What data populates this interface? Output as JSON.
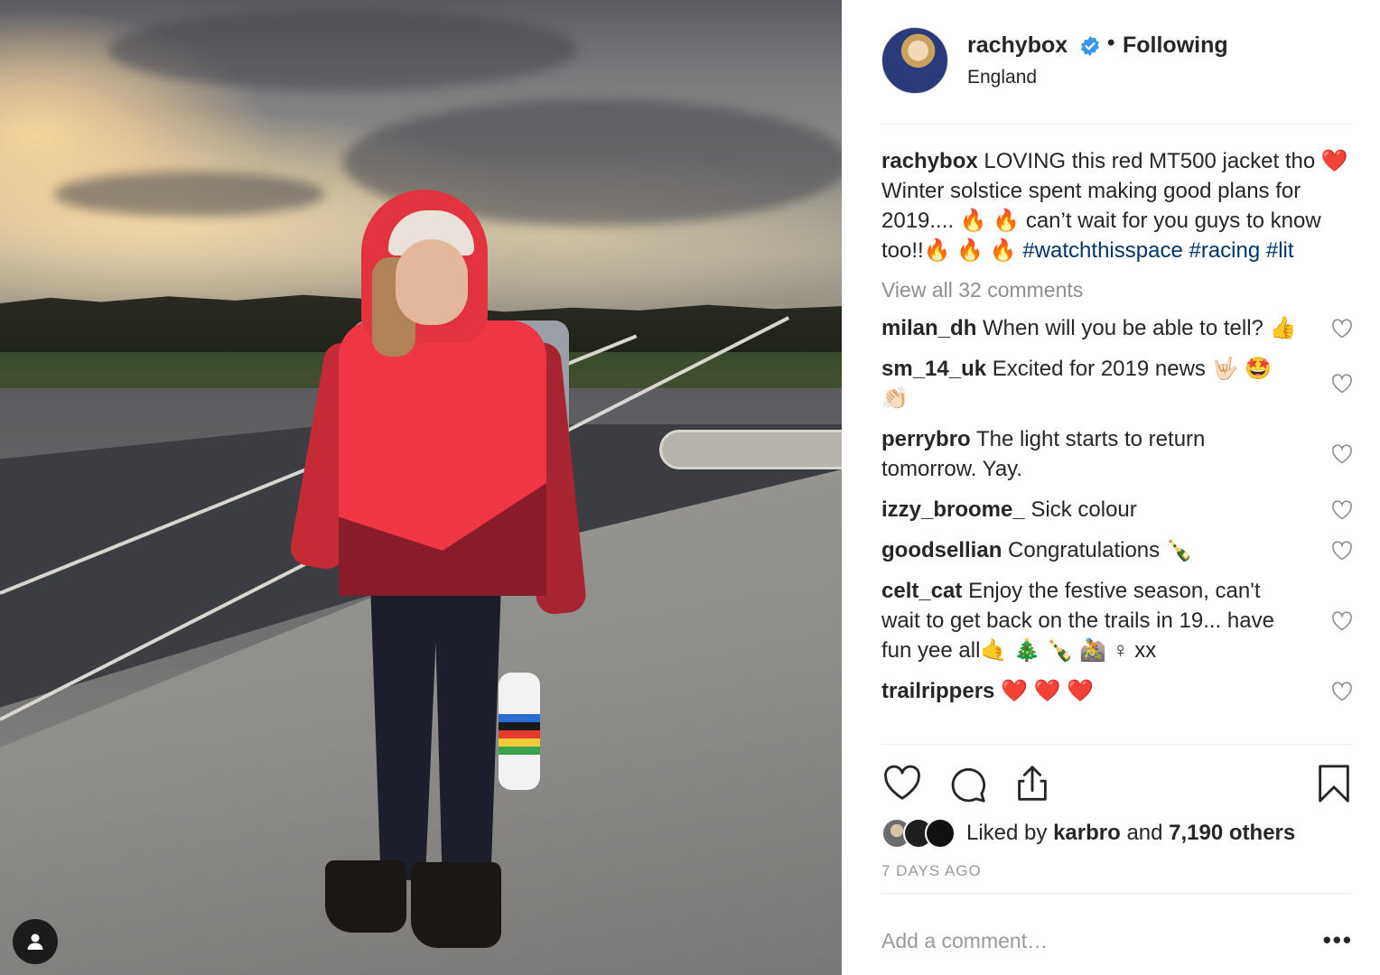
{
  "post": {
    "username": "rachybox",
    "follow_state": "Following",
    "separator": "•",
    "location": "England",
    "caption": {
      "username": "rachybox",
      "text": "LOVING this red MT500 jacket tho ❤️ Winter solstice spent making good plans for 2019.... 🔥 🔥 can’t wait for you guys to know too!!🔥 🔥 🔥 ",
      "hashtags": [
        "#watchthisspace",
        "#racing",
        "#lit"
      ]
    },
    "view_all": "View all 32 comments",
    "comments": [
      {
        "user": "milan_dh",
        "text": "When will you be able to tell? 👍"
      },
      {
        "user": "sm_14_uk",
        "text": "Excited for 2019 news 🤟🏻 🤩 👏🏻"
      },
      {
        "user": "perrybro",
        "text": "The light starts to return tomorrow. Yay."
      },
      {
        "user": "izzy_broome_",
        "text": "Sick colour"
      },
      {
        "user": "goodsellian",
        "text": "Congratulations 🍾"
      },
      {
        "user": "celt_cat",
        "text": "Enjoy the festive season, can't wait to get back on the trails in 19... have fun yee all🤙 🎄 🍾 🚵 ♀ xx"
      },
      {
        "user": "trailrippers",
        "text": "❤️ ❤️ ❤️"
      }
    ],
    "likes": {
      "prefix": "Liked by",
      "first_user": "karbro",
      "joiner": "and",
      "others": "7,190 others"
    },
    "timestamp": "7 DAYS AGO",
    "add_comment_placeholder": "Add a comment…",
    "more_label": "•••"
  },
  "colors": {
    "text": "#262626",
    "secondary": "#8e8e8e",
    "hashtag": "#003569",
    "verified": "#3897f0",
    "divider": "#efefef"
  },
  "icons": {
    "verified": "verified-badge-icon",
    "like": "heart-icon",
    "comment": "comment-bubble-icon",
    "share": "share-icon",
    "save": "bookmark-icon",
    "profile": "user-profile-icon"
  }
}
